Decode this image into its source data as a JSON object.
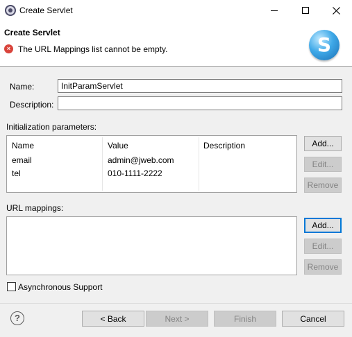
{
  "window": {
    "title": "Create Servlet",
    "icon": "eclipse-icon",
    "controls": {
      "minimize": "minimize",
      "maximize": "maximize",
      "close": "close"
    }
  },
  "header": {
    "title": "Create Servlet",
    "message": "The URL Mappings list cannot be empty.",
    "message_icon": "error-icon",
    "logo_letter": "S"
  },
  "form": {
    "name_label": "Name:",
    "name_value": "InitParamServlet",
    "description_label": "Description:",
    "description_value": ""
  },
  "init_params": {
    "label": "Initialization parameters:",
    "columns": [
      "Name",
      "Value",
      "Description"
    ],
    "rows": [
      {
        "name": "email",
        "value": "admin@jweb.com",
        "description": ""
      },
      {
        "name": "tel",
        "value": "010-1111-2222",
        "description": ""
      }
    ],
    "buttons": {
      "add": "Add...",
      "edit": "Edit...",
      "remove": "Remove"
    }
  },
  "url_mappings": {
    "label": "URL mappings:",
    "items": [],
    "buttons": {
      "add": "Add...",
      "edit": "Edit...",
      "remove": "Remove"
    }
  },
  "async": {
    "label": "Asynchronous Support",
    "checked": false
  },
  "footer": {
    "help_icon": "help-icon",
    "help_glyph": "?",
    "back": "< Back",
    "next": "Next >",
    "finish": "Finish",
    "cancel": "Cancel"
  },
  "colors": {
    "error": "#d9443b",
    "focus": "#0078d7",
    "dialog_bg": "#f0f0f0"
  }
}
